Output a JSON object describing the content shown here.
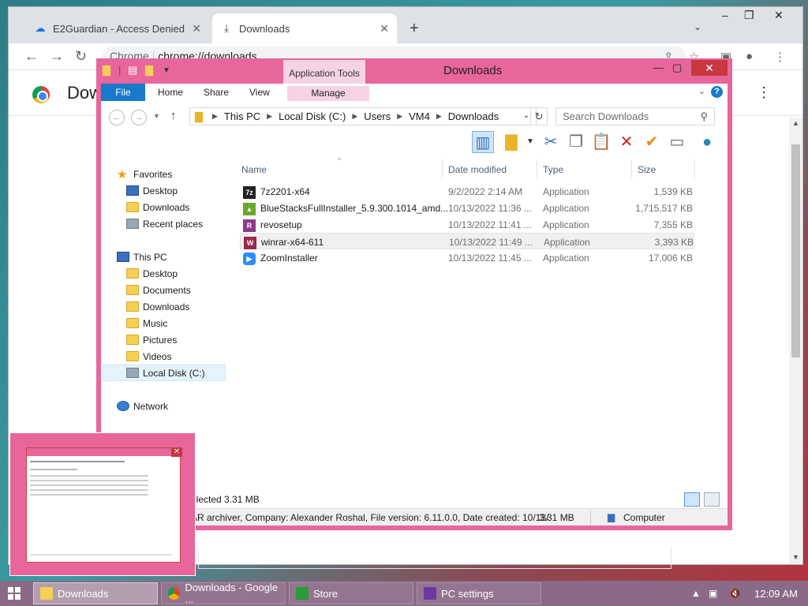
{
  "chrome": {
    "tabs": [
      {
        "label": "E2Guardian - Access Denied"
      },
      {
        "label": "Downloads"
      }
    ],
    "omnibox_prefix": "Chrome",
    "omnibox_url": "chrome://downloads",
    "page_title": "Downloads"
  },
  "explorer": {
    "title": "Downloads",
    "app_tools": "Application Tools",
    "ribbon_tabs": {
      "file": "File",
      "home": "Home",
      "share": "Share",
      "view": "View",
      "manage": "Manage"
    },
    "breadcrumb": [
      "This PC",
      "Local Disk (C:)",
      "Users",
      "VM4",
      "Downloads"
    ],
    "search_placeholder": "Search Downloads",
    "nav": {
      "favorites": "Favorites",
      "favorites_items": [
        "Desktop",
        "Downloads",
        "Recent places"
      ],
      "this_pc": "This PC",
      "this_pc_items": [
        "Desktop",
        "Documents",
        "Downloads",
        "Music",
        "Pictures",
        "Videos",
        "Local Disk (C:)"
      ],
      "network": "Network"
    },
    "columns": {
      "name": "Name",
      "date": "Date modified",
      "type": "Type",
      "size": "Size"
    },
    "files": [
      {
        "name": "7z2201-x64",
        "date": "9/2/2022 2:14 AM",
        "type": "Application",
        "size": "1,539 KB"
      },
      {
        "name": "BlueStacksFullInstaller_5.9.300.1014_amd...",
        "date": "10/13/2022 11:36 ...",
        "type": "Application",
        "size": "1,715,517 KB"
      },
      {
        "name": "revosetup",
        "date": "10/13/2022 11:41 ...",
        "type": "Application",
        "size": "7,355 KB"
      },
      {
        "name": "winrar-x64-611",
        "date": "10/13/2022 11:49 ...",
        "type": "Application",
        "size": "3,393 KB"
      },
      {
        "name": "ZoomInstaller",
        "date": "10/13/2022 11:45 ...",
        "type": "Application",
        "size": "17,006 KB"
      }
    ],
    "status_selected": "elected  3.31 MB",
    "details_text": "AR archiver, Company: Alexander Roshal, File version: 6.11.0.0, Date created: 10/13/",
    "details_size": "3.31 MB",
    "details_location": "Computer"
  },
  "taskbar": {
    "items": [
      {
        "label": "Downloads"
      },
      {
        "label": "Downloads - Google ..."
      },
      {
        "label": "Store"
      },
      {
        "label": "PC settings"
      }
    ],
    "clock": "12:09 AM"
  },
  "colors": {
    "explorer_frame": "#e7669b",
    "close_red": "#c7383f",
    "ribbon_file": "#1979ca",
    "taskbar": "#8a6a86"
  }
}
